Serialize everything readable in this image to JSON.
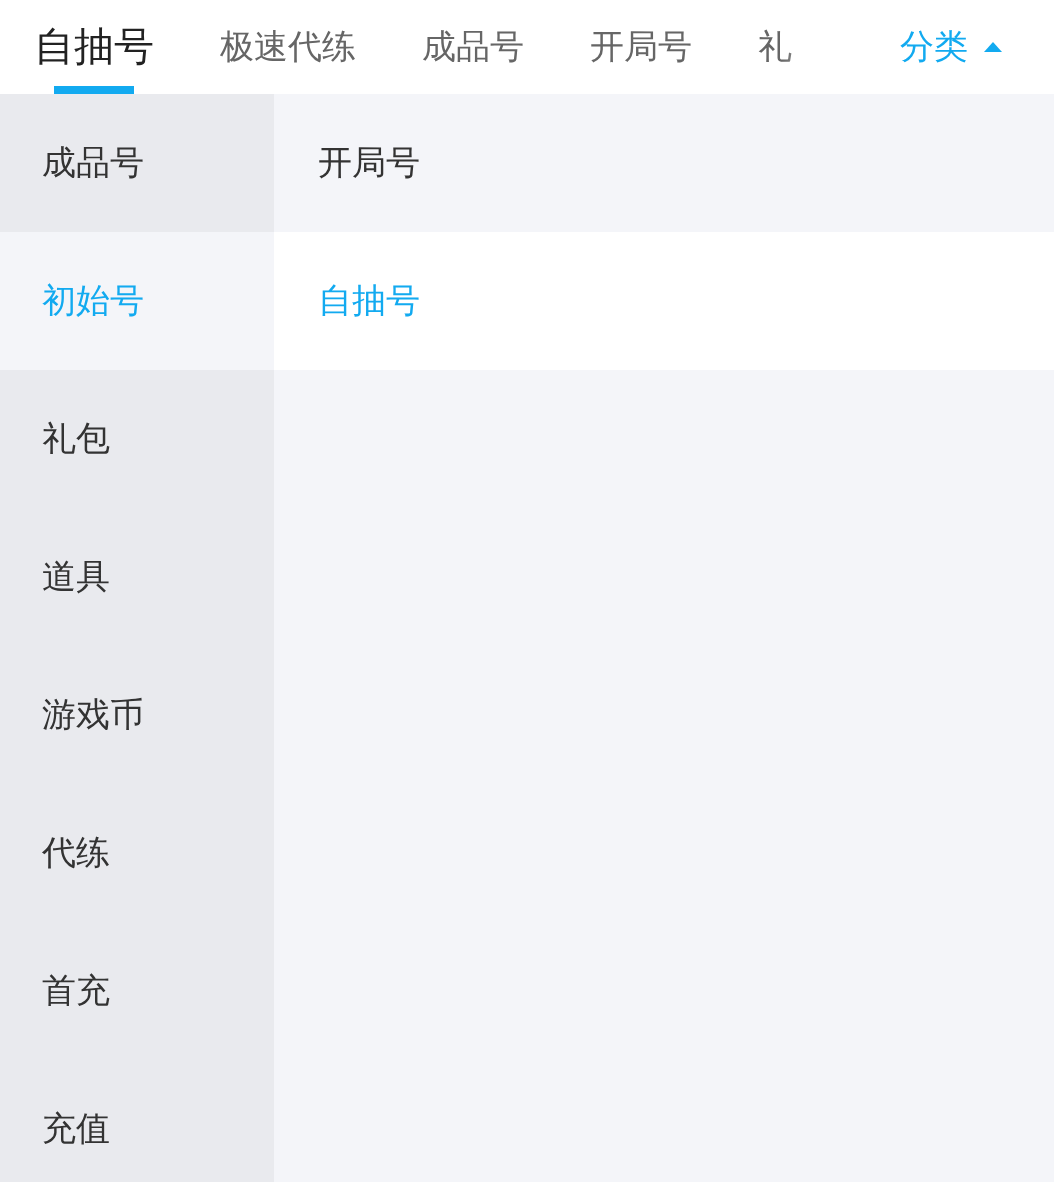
{
  "tabs": [
    {
      "label": "自抽号",
      "selected": true
    },
    {
      "label": "极速代练",
      "selected": false
    },
    {
      "label": "成品号",
      "selected": false
    },
    {
      "label": "开局号",
      "selected": false
    },
    {
      "label": "礼",
      "selected": false
    }
  ],
  "category_button": {
    "label": "分类",
    "expanded": true
  },
  "sidebar": {
    "items": [
      {
        "label": "成品号",
        "selected": false
      },
      {
        "label": "初始号",
        "selected": true
      },
      {
        "label": "礼包",
        "selected": false
      },
      {
        "label": "道具",
        "selected": false
      },
      {
        "label": "游戏币",
        "selected": false
      },
      {
        "label": "代练",
        "selected": false
      },
      {
        "label": "首充",
        "selected": false
      },
      {
        "label": "充值",
        "selected": false
      }
    ]
  },
  "subcategories": [
    {
      "label": "开局号",
      "selected": false
    },
    {
      "label": "自抽号",
      "selected": true
    }
  ]
}
